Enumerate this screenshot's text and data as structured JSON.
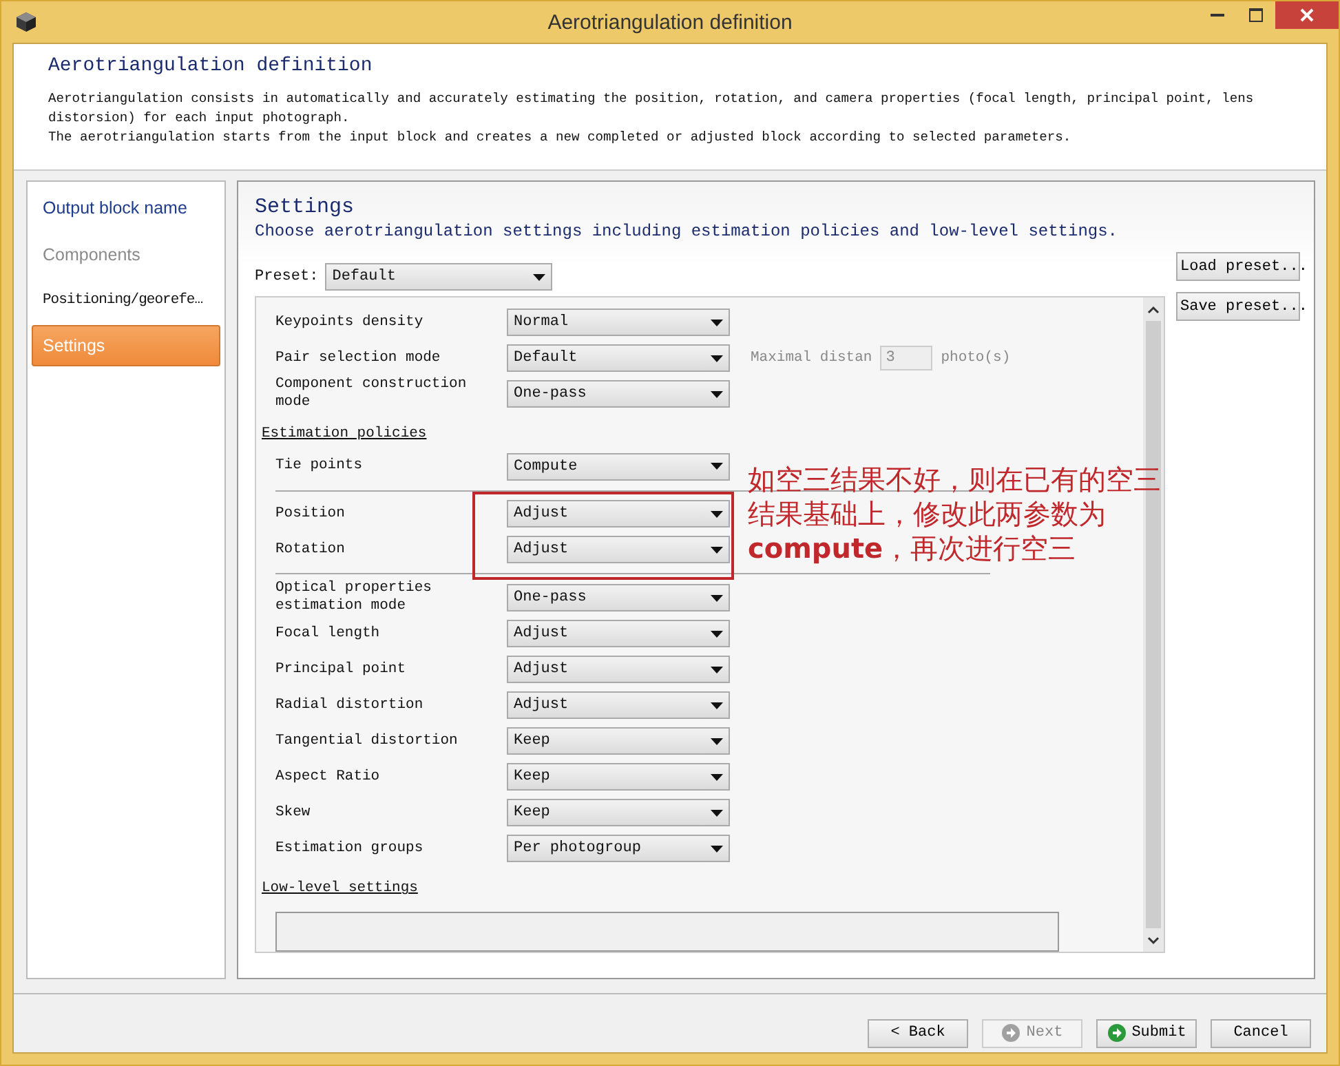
{
  "window": {
    "title": "Aerotriangulation definition"
  },
  "header": {
    "title": "Aerotriangulation definition",
    "paragraphs": [
      "Aerotriangulation consists in automatically and accurately estimating the position, rotation, and camera properties (focal length, principal point, lens distorsion) for each input photograph.",
      "The aerotriangulation starts from the input block and creates a new completed or adjusted block according to selected parameters."
    ]
  },
  "sidebar": {
    "items": [
      {
        "label": "Output block name",
        "selected": false,
        "disabled": false,
        "kind": "link"
      },
      {
        "label": "Components",
        "selected": false,
        "disabled": true,
        "kind": "link"
      },
      {
        "label": "Positioning/georefe…",
        "selected": false,
        "disabled": false,
        "kind": "plain"
      },
      {
        "label": "Settings",
        "selected": true,
        "disabled": false,
        "kind": "link"
      }
    ]
  },
  "settings": {
    "title": "Settings",
    "subtitle": "Choose aerotriangulation settings including estimation policies and low-level settings.",
    "preset": {
      "label": "Preset:",
      "value": "Default"
    },
    "preset_buttons": [
      "Load preset...",
      "Save preset..."
    ],
    "form": [
      {
        "kind": "combo",
        "label": "Keypoints density",
        "value": "Normal"
      },
      {
        "kind": "combo",
        "label": "Pair selection mode",
        "value": "Default",
        "extra": {
          "label": "Maximal distan",
          "value": "3",
          "unit": "photo(s)",
          "disabled": true
        }
      },
      {
        "kind": "combo",
        "label": "Component construction mode",
        "value": "One-pass"
      },
      {
        "kind": "heading",
        "label": "Estimation policies"
      },
      {
        "kind": "combo",
        "label": "Tie points",
        "value": "Compute"
      },
      {
        "kind": "rule"
      },
      {
        "kind": "combo",
        "label": "Position",
        "value": "Adjust"
      },
      {
        "kind": "combo",
        "label": "Rotation",
        "value": "Adjust"
      },
      {
        "kind": "rule"
      },
      {
        "kind": "combo",
        "label": "Optical properties estimation mode",
        "value": "One-pass"
      },
      {
        "kind": "combo",
        "label": "Focal length",
        "value": "Adjust"
      },
      {
        "kind": "combo",
        "label": "Principal point",
        "value": "Adjust"
      },
      {
        "kind": "combo",
        "label": "Radial distortion",
        "value": "Adjust"
      },
      {
        "kind": "combo",
        "label": "Tangential distortion",
        "value": "Keep"
      },
      {
        "kind": "combo",
        "label": "Aspect Ratio",
        "value": "Keep"
      },
      {
        "kind": "combo",
        "label": "Skew",
        "value": "Keep"
      },
      {
        "kind": "combo",
        "label": "Estimation groups",
        "value": "Per photogroup"
      },
      {
        "kind": "heading",
        "label": "Low-level settings"
      },
      {
        "kind": "textarea"
      }
    ],
    "annotation": {
      "text": "如空三结果不好，则在已有的空三结果基础上，修改此两参数为**compute**，再次进行空三"
    }
  },
  "footer": {
    "buttons": [
      {
        "label": "< Back",
        "disabled": false,
        "kind": "text"
      },
      {
        "label": "Next",
        "disabled": true,
        "kind": "iconed"
      },
      {
        "label": "Submit",
        "disabled": false,
        "kind": "iconed"
      },
      {
        "label": "Cancel",
        "disabled": false,
        "kind": "text"
      }
    ]
  }
}
